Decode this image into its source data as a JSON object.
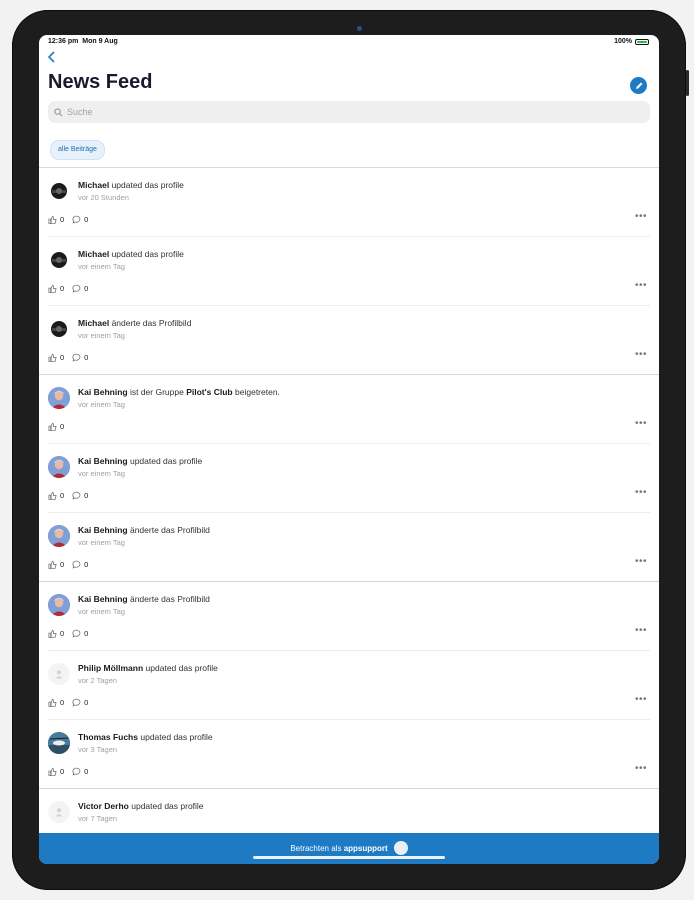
{
  "status": {
    "time": "12:36 pm",
    "date": "Mon 9 Aug",
    "battery": "100%"
  },
  "header": {
    "title": "News Feed",
    "back_icon": "chevron-left-icon",
    "compose_icon": "pencil-icon"
  },
  "search": {
    "placeholder": "Suche"
  },
  "filter": {
    "label": "alle Beiträge"
  },
  "posts": [
    {
      "name": "Michael",
      "action": "updated das profile",
      "time": "vor 20 Stunden",
      "likes": "0",
      "comments": "0",
      "avatar": "helmet",
      "has_comments": true
    },
    {
      "name": "Michael",
      "action": "updated das profile",
      "time": "vor einem Tag",
      "likes": "0",
      "comments": "0",
      "avatar": "helmet",
      "has_comments": true
    },
    {
      "name": "Michael",
      "action": "änderte das Profilbild",
      "time": "vor einem Tag",
      "likes": "0",
      "comments": "0",
      "avatar": "helmet",
      "has_comments": true
    },
    {
      "name": "Kai Behning",
      "action": "ist der Gruppe",
      "group": "Pilot's Club",
      "action_suffix": "beigetreten.",
      "time": "vor einem Tag",
      "likes": "0",
      "avatar": "person",
      "has_comments": false
    },
    {
      "name": "Kai Behning",
      "action": "updated das profile",
      "time": "vor einem Tag",
      "likes": "0",
      "comments": "0",
      "avatar": "person",
      "has_comments": true
    },
    {
      "name": "Kai Behning",
      "action": "änderte das Profilbild",
      "time": "vor einem Tag",
      "likes": "0",
      "comments": "0",
      "avatar": "person",
      "has_comments": true
    },
    {
      "name": "Kai Behning",
      "action": "änderte das Profilbild",
      "time": "vor einem Tag",
      "likes": "0",
      "comments": "0",
      "avatar": "person",
      "has_comments": true
    },
    {
      "name": "Philip Möllmann",
      "action": "updated das profile",
      "time": "vor 2 Tagen",
      "likes": "0",
      "comments": "0",
      "avatar": "blank",
      "has_comments": true
    },
    {
      "name": "Thomas Fuchs",
      "action": "updated das profile",
      "time": "vor 3 Tagen",
      "likes": "0",
      "comments": "0",
      "avatar": "heli",
      "has_comments": true
    },
    {
      "name": "Victor Derho",
      "action": "updated das profile",
      "time": "vor 7 Tagen",
      "avatar": "blank",
      "has_comments": false
    }
  ],
  "footer": {
    "prefix": "Betrachten als",
    "user": "appsupport"
  }
}
